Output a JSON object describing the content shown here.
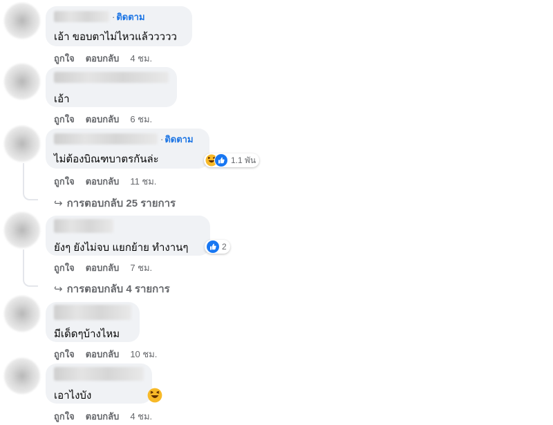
{
  "colors": {
    "link": "#1b74e4",
    "meta": "#65676b",
    "bubble": "#f0f2f5",
    "like_blue": "#1877f2",
    "haha_yellow": "#f7b928"
  },
  "labels": {
    "like": "ถูกใจ",
    "reply": "ตอบกลับ",
    "follow": "ติดตาม",
    "follow_sep": "·"
  },
  "comments": [
    {
      "text": "เอ้า ขอบตาไม่ไหวแล้ววววว",
      "time": "4 ชม."
    },
    {
      "text": "เอ้า",
      "time": "6 ชม."
    },
    {
      "text": "ไม่ต้องบิณฑบาตรกันล่ะ",
      "time": "11 ชม.",
      "reaction_count": "1.1 พัน",
      "reaction_icons": [
        "haha-icon",
        "like-icon"
      ],
      "replies": "การตอบกลับ 25 รายการ"
    },
    {
      "text": "ยังๆ ยังไม่จบ แยกย้าย ทำงานๆ",
      "time": "7 ชม.",
      "reaction_count": "2",
      "reaction_icons": [
        "like-icon"
      ],
      "replies": "การตอบกลับ 4 รายการ"
    },
    {
      "text": "มีเด็ดๆบ้างไหม",
      "time": "10 ชม."
    },
    {
      "text": "เอาไงบัง",
      "time": "4 ชม.",
      "reaction_icons": [
        "haha-icon"
      ]
    }
  ]
}
